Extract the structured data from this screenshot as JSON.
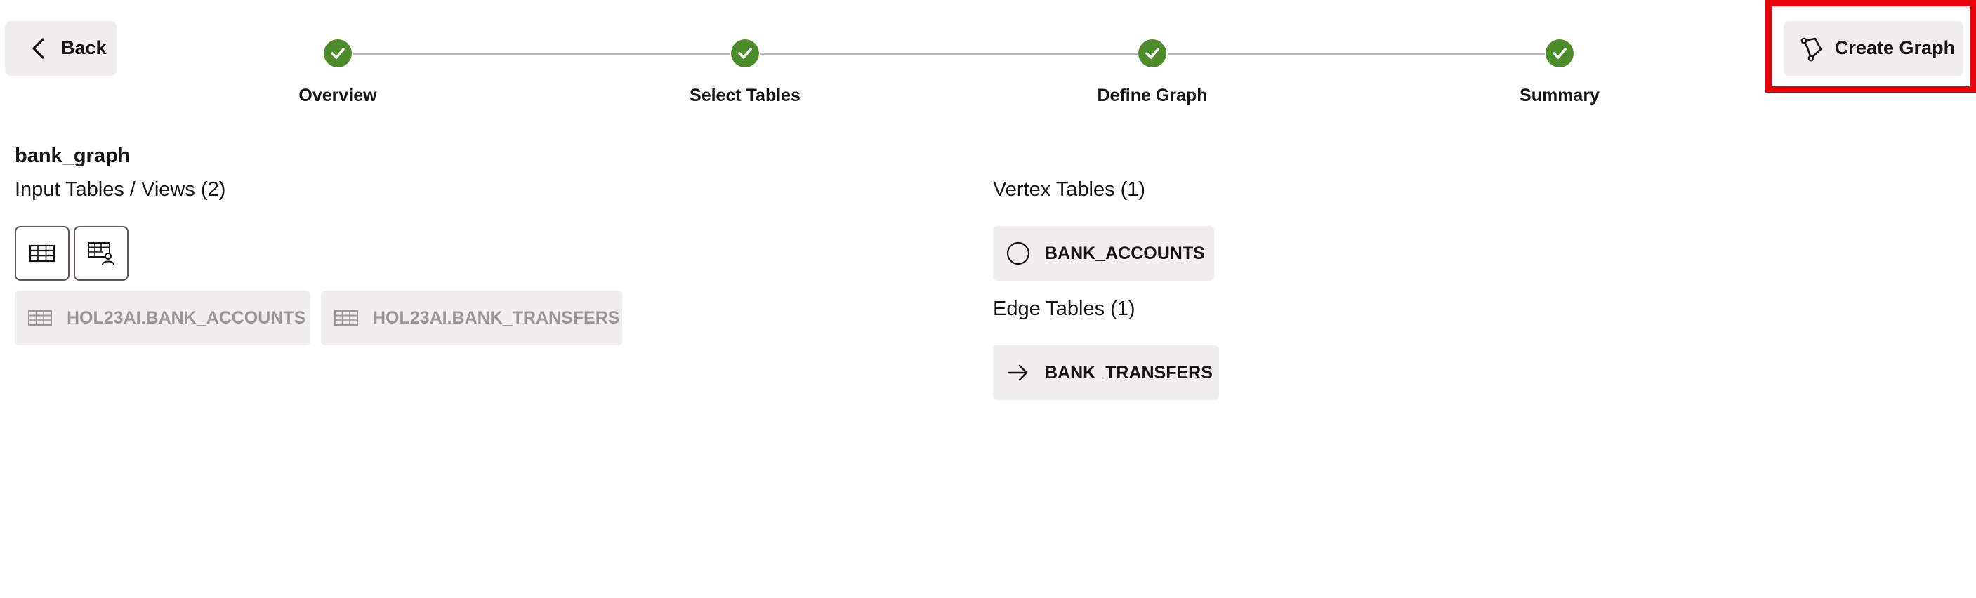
{
  "header": {
    "back_label": "Back",
    "create_graph_label": "Create Graph"
  },
  "stepper": {
    "steps": [
      {
        "label": "Overview",
        "status": "complete"
      },
      {
        "label": "Select Tables",
        "status": "complete"
      },
      {
        "label": "Define Graph",
        "status": "complete"
      },
      {
        "label": "Summary",
        "status": "complete"
      }
    ]
  },
  "summary": {
    "graph_name": "bank_graph",
    "input_tables_label": "Input Tables / Views (2)",
    "input_tables": [
      "HOL23AI.BANK_ACCOUNTS",
      "HOL23AI.BANK_TRANSFERS"
    ],
    "vertex_tables_label": "Vertex Tables (1)",
    "vertex_tables": [
      "BANK_ACCOUNTS"
    ],
    "edge_tables_label": "Edge Tables (1)",
    "edge_tables": [
      "BANK_TRANSFERS"
    ]
  },
  "colors": {
    "step_complete": "#4c8c2b",
    "highlight": "#e8000b",
    "button_bg": "#f1efed"
  },
  "icons": {
    "back": "chevron-left-icon",
    "create_graph": "graph-icon",
    "step_complete": "checkmark-icon",
    "table_view": "table-icon",
    "table_user_view": "table-user-icon",
    "vertex": "circle-icon",
    "edge": "arrow-right-icon"
  }
}
